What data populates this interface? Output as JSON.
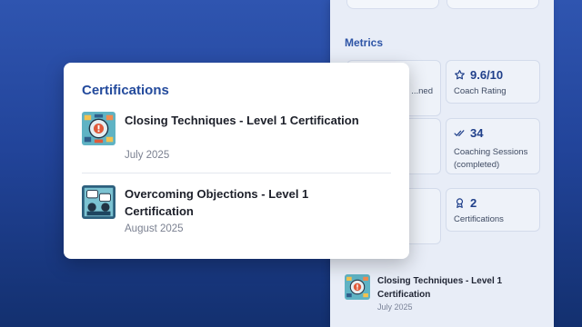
{
  "metrics": {
    "title": "Metrics",
    "cards": [
      {
        "value": "",
        "label": "...ned",
        "icon": "target-icon"
      },
      {
        "value": "9.6/10",
        "label": "Coach Rating",
        "icon": "star-icon"
      },
      {
        "value": "",
        "label": "",
        "icon": ""
      },
      {
        "value": "34",
        "label": "Coaching Sessions (completed)",
        "icon": "double-check-icon"
      },
      {
        "value": "",
        "label": "",
        "icon": ""
      },
      {
        "value": "2",
        "label": "Certifications",
        "icon": "award-icon"
      }
    ]
  },
  "certifications": {
    "title": "Certifications",
    "items": [
      {
        "title": "Closing Techniques - Level 1 Certification",
        "date": "July 2025",
        "icon": "certificate-badge-icon"
      },
      {
        "title": "Overcoming Objections - Level 1 Certification",
        "date": "August 2025",
        "icon": "certificate-chat-icon"
      }
    ]
  },
  "side_list": [
    {
      "title": "Closing Techniques - Level 1 Certification",
      "date": "July 2025"
    }
  ],
  "colors": {
    "accent": "#234a9c",
    "background_top": "#2f55b0",
    "background_bottom": "#13306f",
    "panel": "#e8edf7"
  }
}
